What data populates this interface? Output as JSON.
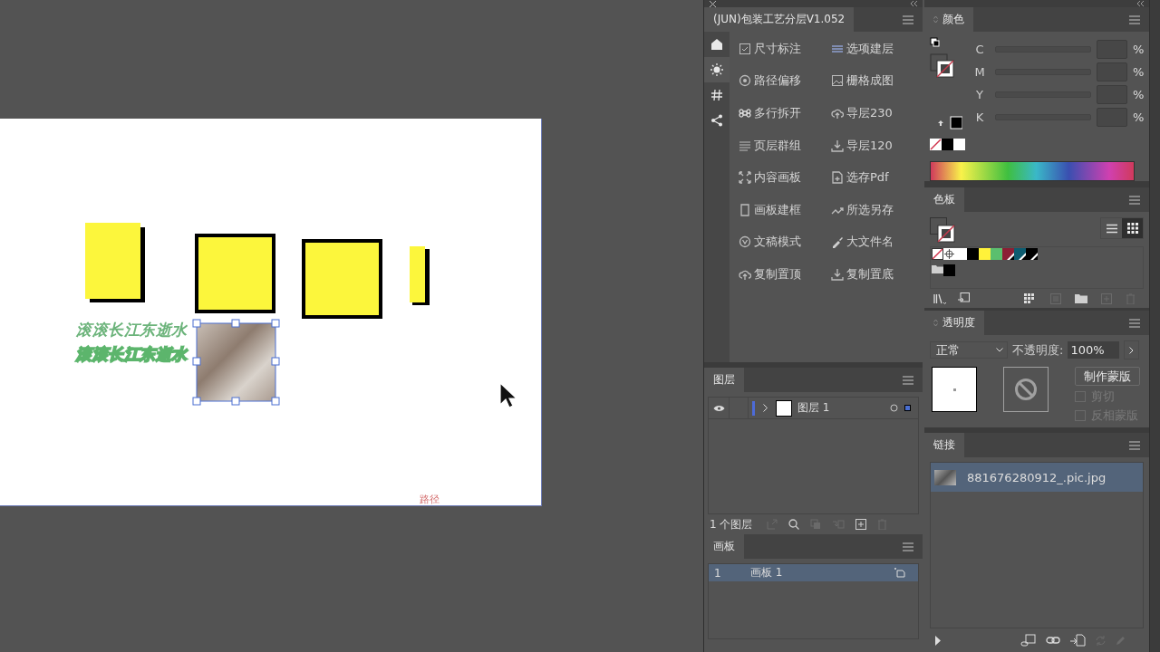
{
  "canvas": {
    "texts": [
      {
        "text": "滚滚长江东逝水",
        "kind": "plain"
      },
      {
        "text": "滚滚长江东逝水",
        "kind": "outlined"
      }
    ],
    "path_label": "路径"
  },
  "plugin_panel": {
    "title": "(JUN)包装工艺分层V1.052",
    "side_tabs": [
      {
        "selected": false
      },
      {
        "selected": true
      },
      {
        "selected": false
      },
      {
        "selected": false
      }
    ],
    "tools": [
      {
        "label": "尺寸标注"
      },
      {
        "label": "选项建层"
      },
      {
        "label": "路径偏移"
      },
      {
        "label": "栅格成图"
      },
      {
        "label": "多行拆开"
      },
      {
        "label": "导层230"
      },
      {
        "label": "页层群组"
      },
      {
        "label": "导层120"
      },
      {
        "label": "内容画板"
      },
      {
        "label": "选存Pdf"
      },
      {
        "label": "画板建框"
      },
      {
        "label": "所选另存"
      },
      {
        "label": "文稿模式"
      },
      {
        "label": "大文件名"
      },
      {
        "label": "复制置顶"
      },
      {
        "label": "复制置底"
      }
    ]
  },
  "layers_panel": {
    "title": "图层",
    "rows": [
      {
        "name": "图层 1",
        "visible": true,
        "expanded": false
      }
    ],
    "count": "1 个图层"
  },
  "artboards_panel": {
    "title": "画板",
    "rows": [
      {
        "number": "1",
        "name": "画板 1",
        "selected": true
      }
    ]
  },
  "color_panel": {
    "title": "颜色",
    "channels": [
      {
        "name": "C",
        "unit": "%"
      },
      {
        "name": "M",
        "unit": "%"
      },
      {
        "name": "Y",
        "unit": "%"
      },
      {
        "name": "K",
        "unit": "%"
      }
    ]
  },
  "swatches_panel": {
    "title": "色板",
    "views": [
      {
        "selected": false
      },
      {
        "selected": true
      }
    ],
    "swatches": [
      {
        "kind": "none"
      },
      {
        "kind": "registration"
      },
      {
        "kind": "solid",
        "color": "#ffffff"
      },
      {
        "kind": "solid",
        "color": "#000000"
      },
      {
        "kind": "solid",
        "color": "#fff23a"
      },
      {
        "kind": "solid",
        "color": "#5bbf6e"
      },
      {
        "kind": "global",
        "color": "#8c1f35"
      },
      {
        "kind": "global",
        "color": "#0d5c70"
      },
      {
        "kind": "global",
        "color": "#000000"
      }
    ],
    "group_swatches": [
      {
        "kind": "solid",
        "color": "#000000"
      }
    ]
  },
  "transparency_panel": {
    "title": "透明度",
    "blend_mode": "正常",
    "opacity_label": "不透明度:",
    "opacity": "100%",
    "mask_button": "制作蒙版",
    "options": [
      {
        "label": "剪切",
        "checked": false,
        "disabled": true
      },
      {
        "label": "反相蒙版",
        "checked": false,
        "disabled": true
      }
    ]
  },
  "links_panel": {
    "title": "链接",
    "rows": [
      {
        "name": "881676280912_.pic.jpg",
        "selected": true
      }
    ]
  }
}
